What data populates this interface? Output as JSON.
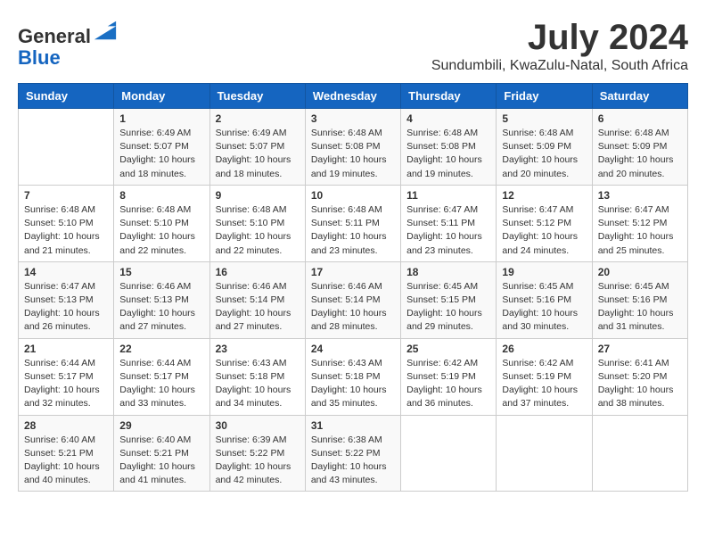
{
  "logo": {
    "general": "General",
    "blue": "Blue"
  },
  "header": {
    "month": "July 2024",
    "location": "Sundumbili, KwaZulu-Natal, South Africa"
  },
  "weekdays": [
    "Sunday",
    "Monday",
    "Tuesday",
    "Wednesday",
    "Thursday",
    "Friday",
    "Saturday"
  ],
  "weeks": [
    [
      {
        "day": "",
        "sunrise": "",
        "sunset": "",
        "daylight": ""
      },
      {
        "day": "1",
        "sunrise": "Sunrise: 6:49 AM",
        "sunset": "Sunset: 5:07 PM",
        "daylight": "Daylight: 10 hours and 18 minutes."
      },
      {
        "day": "2",
        "sunrise": "Sunrise: 6:49 AM",
        "sunset": "Sunset: 5:07 PM",
        "daylight": "Daylight: 10 hours and 18 minutes."
      },
      {
        "day": "3",
        "sunrise": "Sunrise: 6:48 AM",
        "sunset": "Sunset: 5:08 PM",
        "daylight": "Daylight: 10 hours and 19 minutes."
      },
      {
        "day": "4",
        "sunrise": "Sunrise: 6:48 AM",
        "sunset": "Sunset: 5:08 PM",
        "daylight": "Daylight: 10 hours and 19 minutes."
      },
      {
        "day": "5",
        "sunrise": "Sunrise: 6:48 AM",
        "sunset": "Sunset: 5:09 PM",
        "daylight": "Daylight: 10 hours and 20 minutes."
      },
      {
        "day": "6",
        "sunrise": "Sunrise: 6:48 AM",
        "sunset": "Sunset: 5:09 PM",
        "daylight": "Daylight: 10 hours and 20 minutes."
      }
    ],
    [
      {
        "day": "7",
        "sunrise": "Sunrise: 6:48 AM",
        "sunset": "Sunset: 5:10 PM",
        "daylight": "Daylight: 10 hours and 21 minutes."
      },
      {
        "day": "8",
        "sunrise": "Sunrise: 6:48 AM",
        "sunset": "Sunset: 5:10 PM",
        "daylight": "Daylight: 10 hours and 22 minutes."
      },
      {
        "day": "9",
        "sunrise": "Sunrise: 6:48 AM",
        "sunset": "Sunset: 5:10 PM",
        "daylight": "Daylight: 10 hours and 22 minutes."
      },
      {
        "day": "10",
        "sunrise": "Sunrise: 6:48 AM",
        "sunset": "Sunset: 5:11 PM",
        "daylight": "Daylight: 10 hours and 23 minutes."
      },
      {
        "day": "11",
        "sunrise": "Sunrise: 6:47 AM",
        "sunset": "Sunset: 5:11 PM",
        "daylight": "Daylight: 10 hours and 23 minutes."
      },
      {
        "day": "12",
        "sunrise": "Sunrise: 6:47 AM",
        "sunset": "Sunset: 5:12 PM",
        "daylight": "Daylight: 10 hours and 24 minutes."
      },
      {
        "day": "13",
        "sunrise": "Sunrise: 6:47 AM",
        "sunset": "Sunset: 5:12 PM",
        "daylight": "Daylight: 10 hours and 25 minutes."
      }
    ],
    [
      {
        "day": "14",
        "sunrise": "Sunrise: 6:47 AM",
        "sunset": "Sunset: 5:13 PM",
        "daylight": "Daylight: 10 hours and 26 minutes."
      },
      {
        "day": "15",
        "sunrise": "Sunrise: 6:46 AM",
        "sunset": "Sunset: 5:13 PM",
        "daylight": "Daylight: 10 hours and 27 minutes."
      },
      {
        "day": "16",
        "sunrise": "Sunrise: 6:46 AM",
        "sunset": "Sunset: 5:14 PM",
        "daylight": "Daylight: 10 hours and 27 minutes."
      },
      {
        "day": "17",
        "sunrise": "Sunrise: 6:46 AM",
        "sunset": "Sunset: 5:14 PM",
        "daylight": "Daylight: 10 hours and 28 minutes."
      },
      {
        "day": "18",
        "sunrise": "Sunrise: 6:45 AM",
        "sunset": "Sunset: 5:15 PM",
        "daylight": "Daylight: 10 hours and 29 minutes."
      },
      {
        "day": "19",
        "sunrise": "Sunrise: 6:45 AM",
        "sunset": "Sunset: 5:16 PM",
        "daylight": "Daylight: 10 hours and 30 minutes."
      },
      {
        "day": "20",
        "sunrise": "Sunrise: 6:45 AM",
        "sunset": "Sunset: 5:16 PM",
        "daylight": "Daylight: 10 hours and 31 minutes."
      }
    ],
    [
      {
        "day": "21",
        "sunrise": "Sunrise: 6:44 AM",
        "sunset": "Sunset: 5:17 PM",
        "daylight": "Daylight: 10 hours and 32 minutes."
      },
      {
        "day": "22",
        "sunrise": "Sunrise: 6:44 AM",
        "sunset": "Sunset: 5:17 PM",
        "daylight": "Daylight: 10 hours and 33 minutes."
      },
      {
        "day": "23",
        "sunrise": "Sunrise: 6:43 AM",
        "sunset": "Sunset: 5:18 PM",
        "daylight": "Daylight: 10 hours and 34 minutes."
      },
      {
        "day": "24",
        "sunrise": "Sunrise: 6:43 AM",
        "sunset": "Sunset: 5:18 PM",
        "daylight": "Daylight: 10 hours and 35 minutes."
      },
      {
        "day": "25",
        "sunrise": "Sunrise: 6:42 AM",
        "sunset": "Sunset: 5:19 PM",
        "daylight": "Daylight: 10 hours and 36 minutes."
      },
      {
        "day": "26",
        "sunrise": "Sunrise: 6:42 AM",
        "sunset": "Sunset: 5:19 PM",
        "daylight": "Daylight: 10 hours and 37 minutes."
      },
      {
        "day": "27",
        "sunrise": "Sunrise: 6:41 AM",
        "sunset": "Sunset: 5:20 PM",
        "daylight": "Daylight: 10 hours and 38 minutes."
      }
    ],
    [
      {
        "day": "28",
        "sunrise": "Sunrise: 6:40 AM",
        "sunset": "Sunset: 5:21 PM",
        "daylight": "Daylight: 10 hours and 40 minutes."
      },
      {
        "day": "29",
        "sunrise": "Sunrise: 6:40 AM",
        "sunset": "Sunset: 5:21 PM",
        "daylight": "Daylight: 10 hours and 41 minutes."
      },
      {
        "day": "30",
        "sunrise": "Sunrise: 6:39 AM",
        "sunset": "Sunset: 5:22 PM",
        "daylight": "Daylight: 10 hours and 42 minutes."
      },
      {
        "day": "31",
        "sunrise": "Sunrise: 6:38 AM",
        "sunset": "Sunset: 5:22 PM",
        "daylight": "Daylight: 10 hours and 43 minutes."
      },
      {
        "day": "",
        "sunrise": "",
        "sunset": "",
        "daylight": ""
      },
      {
        "day": "",
        "sunrise": "",
        "sunset": "",
        "daylight": ""
      },
      {
        "day": "",
        "sunrise": "",
        "sunset": "",
        "daylight": ""
      }
    ]
  ]
}
